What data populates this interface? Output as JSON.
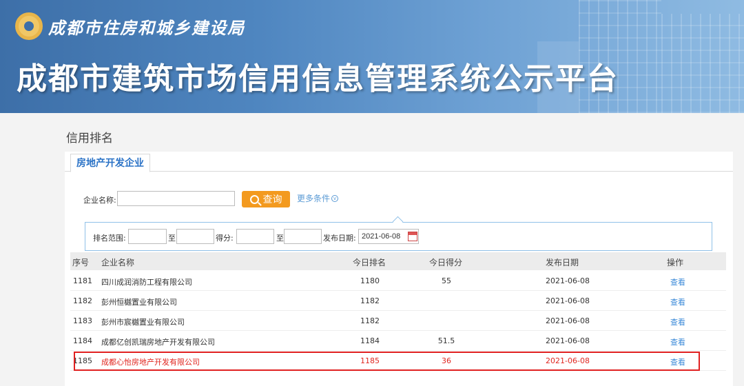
{
  "header": {
    "org_name": "成都市住房和城乡建设局",
    "platform_title": "成都市建筑市场信用信息管理系统公示平台"
  },
  "section_title": "信用排名",
  "tabs": [
    {
      "label": "房地产开发企业"
    }
  ],
  "search": {
    "company_label": "企业名称:",
    "company_value": "",
    "query_button": "查询",
    "more_conditions": "更多条件"
  },
  "filters": {
    "rank_range_label": "排名范围:",
    "to_label_1": "至",
    "score_label": "得分:",
    "to_label_2": "至",
    "date_label": "发布日期:",
    "date_value": "2021-06-08"
  },
  "table": {
    "headers": [
      "序号",
      "企业名称",
      "今日排名",
      "今日得分",
      "发布日期",
      "操作"
    ],
    "rows": [
      {
        "no": "1181",
        "name": "四川成润消防工程有限公司",
        "rank": "1180",
        "score": "55",
        "date": "2021-06-08",
        "action": "查看"
      },
      {
        "no": "1182",
        "name": "彭州恒樾置业有限公司",
        "rank": "1182",
        "score": "",
        "date": "2021-06-08",
        "action": "查看"
      },
      {
        "no": "1183",
        "name": "彭州市宸樾置业有限公司",
        "rank": "1182",
        "score": "",
        "date": "2021-06-08",
        "action": "查看"
      },
      {
        "no": "1184",
        "name": "成都亿创凯瑞房地产开发有限公司",
        "rank": "1184",
        "score": "51.5",
        "date": "2021-06-08",
        "action": "查看"
      },
      {
        "no": "1185",
        "name": "成都心怡房地产开发有限公司",
        "rank": "1185",
        "score": "36",
        "date": "2021-06-08",
        "action": "查看"
      }
    ]
  },
  "colors": {
    "accent": "#2a72c6",
    "button": "#f39a1f",
    "highlight": "#e02020"
  }
}
